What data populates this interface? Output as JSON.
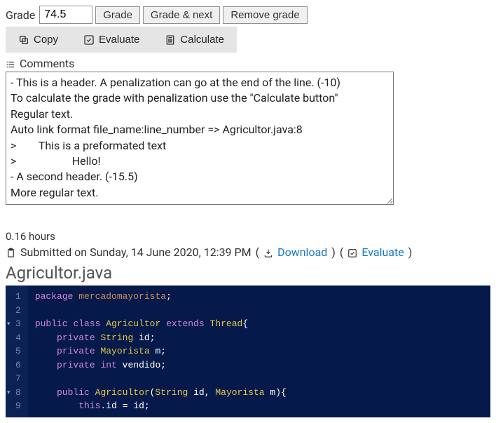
{
  "grade": {
    "label": "Grade",
    "value": "74.5",
    "buttons": {
      "grade": "Grade",
      "grade_next": "Grade & next",
      "remove": "Remove grade"
    }
  },
  "toolbar": {
    "copy": "Copy",
    "evaluate": "Evaluate",
    "calculate": "Calculate"
  },
  "comments": {
    "label": "Comments",
    "text": "- This is a header. A penalization can go at the end of the line. (-10)\nTo calculate the grade with penalization use the \"Calculate button\"\nRegular text.\nAuto link format file_name:line_number => Agricultor.java:8\n>        This is a preformated text\n>                    Hello!\n- A second header. (-15.5)\nMore regular text."
  },
  "submission": {
    "hours": "0.16 hours",
    "submitted_prefix": "Submitted on ",
    "submitted_date": "Sunday, 14 June 2020, 12:39 PM",
    "download": "Download",
    "evaluate": "Evaluate"
  },
  "file": {
    "name": "Agricultor.java"
  },
  "code": {
    "lines": [
      {
        "n": 1,
        "fold": false,
        "tokens": [
          [
            "kw",
            "package"
          ],
          [
            "sp",
            " "
          ],
          [
            "pkg",
            "mercadomayorista"
          ],
          [
            "punct",
            ";"
          ]
        ]
      },
      {
        "n": 2,
        "fold": false,
        "tokens": []
      },
      {
        "n": 3,
        "fold": true,
        "tokens": [
          [
            "kw",
            "public"
          ],
          [
            "sp",
            " "
          ],
          [
            "kw",
            "class"
          ],
          [
            "sp",
            " "
          ],
          [
            "type",
            "Agricultor"
          ],
          [
            "sp",
            " "
          ],
          [
            "kw",
            "extends"
          ],
          [
            "sp",
            " "
          ],
          [
            "type",
            "Thread"
          ],
          [
            "punct",
            "{"
          ]
        ]
      },
      {
        "n": 4,
        "fold": false,
        "tokens": [
          [
            "sp",
            "    "
          ],
          [
            "kw",
            "private"
          ],
          [
            "sp",
            " "
          ],
          [
            "type",
            "String"
          ],
          [
            "sp",
            " "
          ],
          [
            "ident",
            "id"
          ],
          [
            "punct",
            ";"
          ]
        ]
      },
      {
        "n": 5,
        "fold": false,
        "tokens": [
          [
            "sp",
            "    "
          ],
          [
            "kw",
            "private"
          ],
          [
            "sp",
            " "
          ],
          [
            "type",
            "Mayorista"
          ],
          [
            "sp",
            " "
          ],
          [
            "ident",
            "m"
          ],
          [
            "punct",
            ";"
          ]
        ]
      },
      {
        "n": 6,
        "fold": false,
        "tokens": [
          [
            "sp",
            "    "
          ],
          [
            "kw",
            "private"
          ],
          [
            "sp",
            " "
          ],
          [
            "kw",
            "int"
          ],
          [
            "sp",
            " "
          ],
          [
            "ident",
            "vendido"
          ],
          [
            "punct",
            ";"
          ]
        ]
      },
      {
        "n": 7,
        "fold": false,
        "tokens": []
      },
      {
        "n": 8,
        "fold": true,
        "tokens": [
          [
            "sp",
            "    "
          ],
          [
            "kw",
            "public"
          ],
          [
            "sp",
            " "
          ],
          [
            "type",
            "Agricultor"
          ],
          [
            "punct",
            "("
          ],
          [
            "type",
            "String"
          ],
          [
            "sp",
            " "
          ],
          [
            "ident",
            "id"
          ],
          [
            "punct",
            ","
          ],
          [
            "sp",
            " "
          ],
          [
            "type",
            "Mayorista"
          ],
          [
            "sp",
            " "
          ],
          [
            "ident",
            "m"
          ],
          [
            "punct",
            ")"
          ],
          [
            "punct",
            "{"
          ]
        ]
      },
      {
        "n": 9,
        "fold": false,
        "tokens": [
          [
            "sp",
            "        "
          ],
          [
            "this",
            "this"
          ],
          [
            "punct",
            "."
          ],
          [
            "ident",
            "id"
          ],
          [
            "sp",
            " "
          ],
          [
            "op",
            "="
          ],
          [
            "sp",
            " "
          ],
          [
            "ident",
            "id"
          ],
          [
            "punct",
            ";"
          ]
        ]
      }
    ]
  }
}
